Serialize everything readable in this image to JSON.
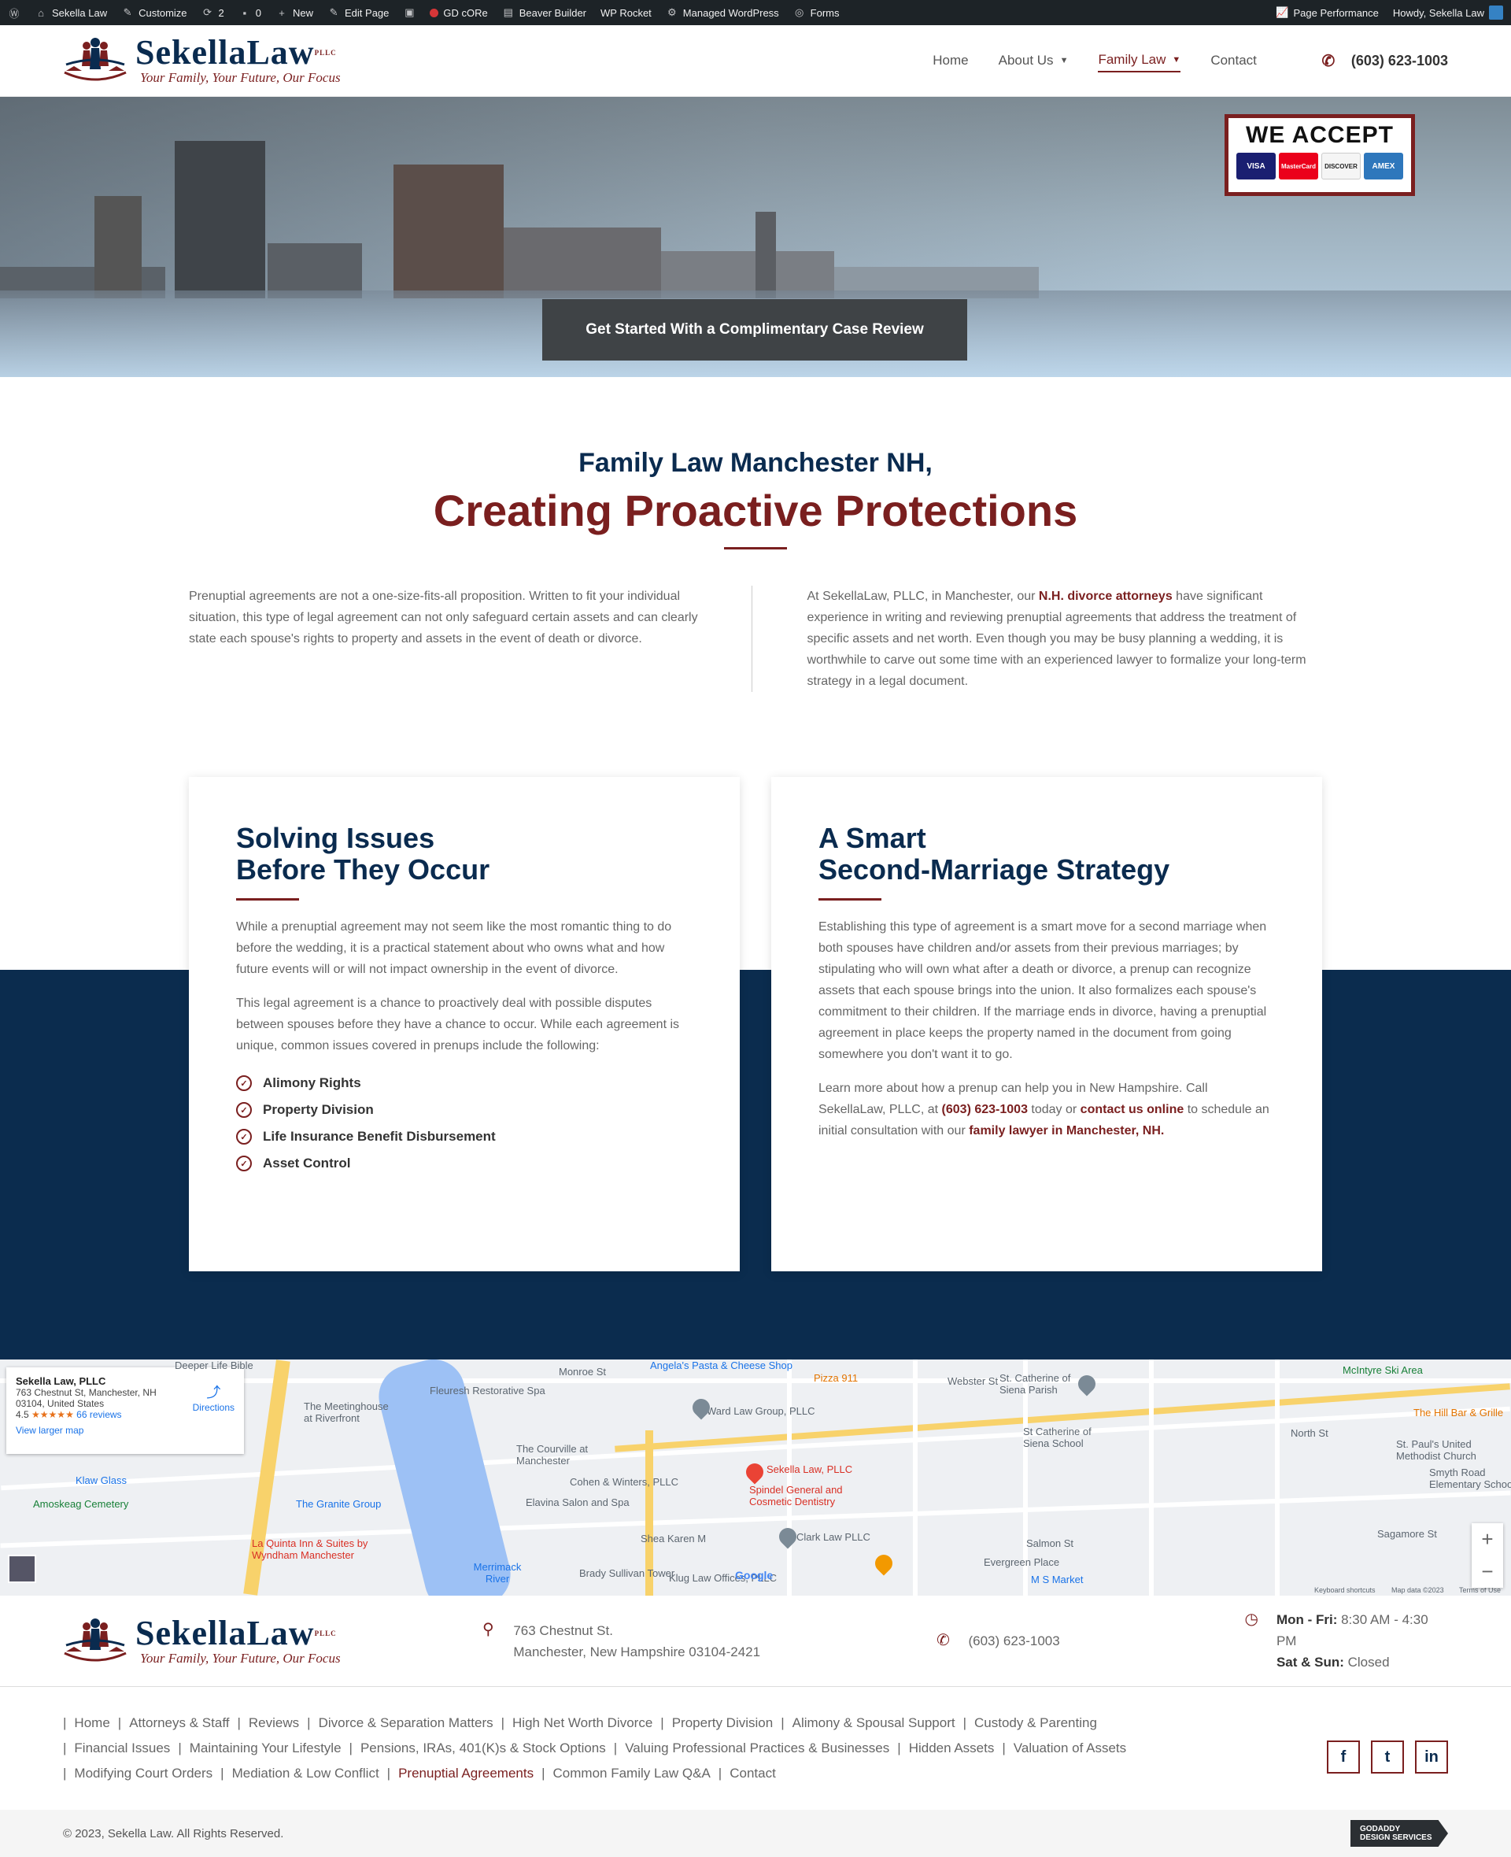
{
  "adminbar": {
    "site": "Sekella Law",
    "customize": "Customize",
    "updates": "2",
    "comments": "0",
    "new": "New",
    "edit_page": "Edit Page",
    "gd_core": "GD cORe",
    "beaver": "Beaver Builder",
    "wp_rocket": "WP Rocket",
    "managed": "Managed WordPress",
    "forms": "Forms",
    "page_performance": "Page Performance",
    "howdy": "Howdy, Sekella Law"
  },
  "header": {
    "logo_name_a": "Sekella",
    "logo_name_b": "Law",
    "logo_pllc": "PLLC",
    "logo_tagline": "Your Family, Your Future, Our Focus",
    "nav": {
      "home": "Home",
      "about": "About Us",
      "family": "Family Law",
      "contact": "Contact"
    },
    "phone": "(603) 623-1003"
  },
  "hero": {
    "accept_title": "WE ACCEPT",
    "cards": [
      "VISA",
      "MasterCard",
      "DISCOVER",
      "AMEX"
    ],
    "cta": "Get Started With a Complimentary Case Review"
  },
  "intro": {
    "subtitle": "Family Law Manchester NH,",
    "title": "Creating Proactive Protections",
    "left_text": "Prenuptial agreements are not a one-size-fits-all proposition. Written to fit your individual situation, this type of legal agreement can not only safeguard certain assets and can clearly state each spouse's rights to property and assets in the event of death or divorce.",
    "right_a": "At SekellaLaw, PLLC, in Manchester, our ",
    "right_link": "N.H. divorce attorneys",
    "right_b": " have significant experience in writing and reviewing prenuptial agreements that address the treatment of specific assets and net worth. Even though you may be busy planning a wedding, it is worthwhile to carve out some time with an experienced lawyer to formalize your long-term strategy in a legal document."
  },
  "box_left": {
    "title_1": "Solving Issues",
    "title_2": "Before They Occur",
    "p1": "While a prenuptial agreement may not seem like the most romantic thing to do before the wedding, it is a practical statement about who owns what and how future events will or will not impact ownership in the event of divorce.",
    "p2": "This legal agreement is a chance to proactively deal with possible disputes between spouses before they have a chance to occur. While each agreement is unique, common issues covered in prenups include the following:",
    "items": [
      "Alimony Rights",
      "Property Division",
      "Life Insurance Benefit Disbursement",
      "Asset Control"
    ]
  },
  "box_right": {
    "title_1": "A Smart",
    "title_2": "Second-Marriage Strategy",
    "p1": "Establishing this type of agreement is a smart move for a second marriage when both spouses have children and/or assets from their previous marriages; by stipulating who will own what after a death or divorce, a prenup can recognize assets that each spouse brings into the union. It also formalizes each spouse's commitment to their children. If the marriage ends in divorce, having a prenuptial agreement in place keeps the property named in the document from going somewhere you don't want it to go.",
    "p2_a": "Learn more about how a prenup can help you in New Hampshire. Call SekellaLaw, PLLC, at ",
    "p2_phone": "(603) 623-1003",
    "p2_b": " today or ",
    "p2_contact": "contact us online",
    "p2_c": " to schedule an initial consultation with our ",
    "p2_link": "family lawyer in Manchester, NH."
  },
  "map": {
    "card_name": "Sekella Law, PLLC",
    "card_addr1": "763 Chestnut St, Manchester, NH",
    "card_addr2": "03104, United States",
    "rating": "4.5",
    "stars": "★★★★★",
    "reviews": "66 reviews",
    "larger": "View larger map",
    "directions": "Directions",
    "pin_label": "Sekella Law, PLLC",
    "pois": [
      "Deeper Life Bible",
      "Monroe St",
      "Angela's Pasta & Cheese Shop",
      "Pizza 911",
      "Webster St",
      "St. Catherine of Siena Parish",
      "McIntyre Ski Area",
      "The Hill Bar & Grille",
      "Fleuresh Restorative Spa",
      "The Meetinghouse at Riverfront",
      "Ward Law Group, PLLC",
      "St Catherine of Siena School",
      "North St",
      "St. Paul's United Methodist Church",
      "Smyth Road Elementary School",
      "The Courville at Manchester",
      "Cohen & Winters, PLLC",
      "Elavina Salon and Spa",
      "Spindel General and Cosmetic Dentistry",
      "Klaw Glass",
      "Amoskeag Cemetery",
      "The Granite Group",
      "Shea Karen M",
      "Clark Law PLLC",
      "Salmon St",
      "Sagamore St",
      "La Quinta Inn & Suites by Wyndham Manchester",
      "Merrimack River",
      "Brady Sullivan Tower",
      "Klug Law Offices, PLLC",
      "Evergreen Place",
      "M S Market",
      "Keyboard shortcuts",
      "Map data ©2023",
      "Terms of Use",
      "Google"
    ]
  },
  "footer": {
    "addr1": "763 Chestnut St.",
    "addr2": "Manchester, New Hampshire 03104-2421",
    "phone": "(603) 623-1003",
    "hours1_label": "Mon - Fri:",
    "hours1": " 8:30 AM - 4:30 PM",
    "hours2_label": "Sat & Sun:",
    "hours2": " Closed",
    "links": [
      "Home",
      "Attorneys & Staff",
      "Reviews",
      "Divorce & Separation Matters",
      "High Net Worth Divorce",
      "Property Division",
      "Alimony & Spousal Support",
      "Custody & Parenting",
      "Financial Issues",
      "Maintaining Your Lifestyle",
      "Pensions, IRAs, 401(K)s & Stock Options",
      "Valuing Professional Practices & Businesses",
      "Hidden Assets",
      "Valuation of Assets",
      "Modifying Court Orders",
      "Mediation & Low Conflict",
      "Prenuptial Agreements",
      "Common Family Law Q&A",
      "Contact"
    ],
    "copyright": "© 2023, Sekella Law. All Rights Reserved.",
    "badge_1": "GODADDY",
    "badge_2": "DESIGN SERVICES"
  },
  "colors": {
    "navy": "#0b2c4e",
    "maroon": "#7a1f1f",
    "adminbar": "#1d2327"
  }
}
